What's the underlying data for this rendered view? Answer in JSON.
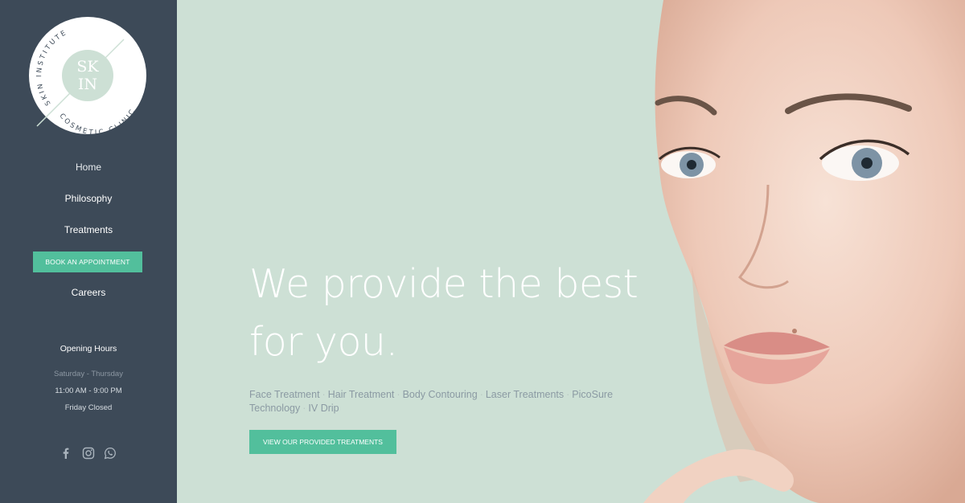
{
  "logo": {
    "monogram_top": "SK",
    "monogram_bottom": "IN",
    "ring_top": "SKIN INSTITUTE",
    "ring_bottom": "COSMETIC CLINIC"
  },
  "nav": {
    "home": "Home",
    "philosophy": "Philosophy",
    "treatments": "Treatments",
    "book": "BOOK AN APPOINTMENT",
    "careers": "Careers"
  },
  "hours": {
    "title": "Opening Hours",
    "days": "Saturday - Thursday",
    "time": "11:00 AM - 9:00 PM",
    "closed": "Friday Closed"
  },
  "social": [
    "facebook-icon",
    "instagram-icon",
    "whatsapp-icon"
  ],
  "hero": {
    "headline": "We provide the best for you.",
    "treatments": [
      "Face Treatment",
      "Hair Treatment",
      "Body Contouring",
      "Laser Treatments",
      "PicoSure Technology",
      "IV Drip"
    ],
    "separator": "·",
    "cta": "VIEW OUR PROVIDED TREATMENTS"
  },
  "colors": {
    "sidebar": "#3d4a58",
    "hero_bg": "#cde0d5",
    "accent": "#52bf9c",
    "logo_disc": "#cde0d5"
  }
}
